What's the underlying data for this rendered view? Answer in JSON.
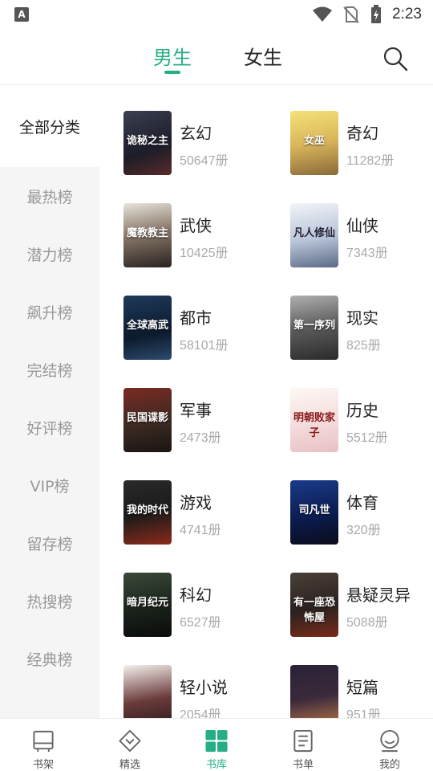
{
  "status_bar": {
    "app_badge": "A",
    "time": "2:23"
  },
  "header": {
    "tabs": [
      {
        "label": "男生",
        "active": true
      },
      {
        "label": "女生",
        "active": false
      }
    ],
    "accent_color": "#27ae87"
  },
  "sidebar": {
    "active": "全部分类",
    "items": [
      "最热榜",
      "潜力榜",
      "飙升榜",
      "完结榜",
      "好评榜",
      "VIP榜",
      "留存榜",
      "热搜榜",
      "经典榜"
    ]
  },
  "categories": [
    {
      "name": "玄幻",
      "count": "50647册",
      "cover_title": "诡秘之主"
    },
    {
      "name": "奇幻",
      "count": "11282册",
      "cover_title": "女巫"
    },
    {
      "name": "武侠",
      "count": "10425册",
      "cover_title": "魔教教主"
    },
    {
      "name": "仙侠",
      "count": "7343册",
      "cover_title": "凡人修仙"
    },
    {
      "name": "都市",
      "count": "58101册",
      "cover_title": "全球高武"
    },
    {
      "name": "现实",
      "count": "825册",
      "cover_title": "第一序列"
    },
    {
      "name": "军事",
      "count": "2473册",
      "cover_title": "民国谍影"
    },
    {
      "name": "历史",
      "count": "5512册",
      "cover_title": "明朝败家子"
    },
    {
      "name": "游戏",
      "count": "4741册",
      "cover_title": "我的时代"
    },
    {
      "name": "体育",
      "count": "320册",
      "cover_title": "司凡世"
    },
    {
      "name": "科幻",
      "count": "6527册",
      "cover_title": "暗月纪元"
    },
    {
      "name": "悬疑灵异",
      "count": "5088册",
      "cover_title": "有一座恐怖屋"
    },
    {
      "name": "轻小说",
      "count": "2054册",
      "cover_title": ""
    },
    {
      "name": "短篇",
      "count": "951册",
      "cover_title": ""
    }
  ],
  "bottom_nav": [
    {
      "label": "书架",
      "icon": "bookshelf-icon",
      "active": false
    },
    {
      "label": "精选",
      "icon": "diamond-icon",
      "active": false
    },
    {
      "label": "书库",
      "icon": "grid-icon",
      "active": true
    },
    {
      "label": "书单",
      "icon": "booklist-icon",
      "active": false
    },
    {
      "label": "我的",
      "icon": "profile-icon",
      "active": false
    }
  ]
}
